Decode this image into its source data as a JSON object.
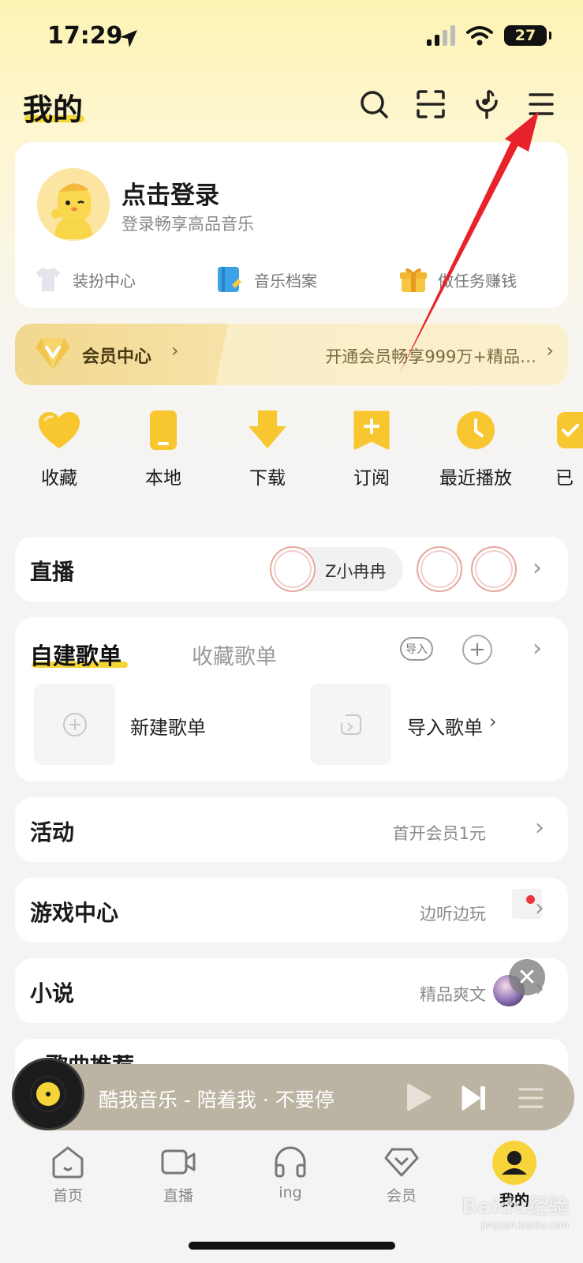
{
  "status": {
    "time": "17:29",
    "battery": "27"
  },
  "header": {
    "title": "我的"
  },
  "profile": {
    "login_title": "点击登录",
    "login_subtitle": "登录畅享高品音乐"
  },
  "quick_links": [
    {
      "label": "装扮中心",
      "icon": "shirt-icon"
    },
    {
      "label": "音乐档案",
      "icon": "notebook-icon"
    },
    {
      "label": "做任务赚钱",
      "icon": "gift-icon"
    }
  ],
  "vip": {
    "title": "会员中心",
    "promo": "开通会员畅享999万+精品…"
  },
  "shortcuts": [
    {
      "label": "收藏",
      "icon": "heart-icon"
    },
    {
      "label": "本地",
      "icon": "phone-icon"
    },
    {
      "label": "下载",
      "icon": "download-icon"
    },
    {
      "label": "订阅",
      "icon": "subscribe-icon"
    },
    {
      "label": "最近播放",
      "icon": "clock-icon"
    },
    {
      "label": "已",
      "icon": "purchased-icon"
    }
  ],
  "live": {
    "label": "直播",
    "streamer": "Z小冉冉"
  },
  "playlists": {
    "tab_created": "自建歌单",
    "tab_collected": "收藏歌单",
    "import_badge": "导入",
    "new_label": "新建歌单",
    "import_label": "导入歌单"
  },
  "rows": {
    "activity": {
      "label": "活动",
      "hint": "首开会员1元"
    },
    "games": {
      "label": "游戏中心",
      "hint": "边听边玩"
    },
    "novel": {
      "label": "小说",
      "hint": "精品爽文"
    },
    "partial": {
      "label": "歌曲推荐"
    }
  },
  "player": {
    "now_playing": "酷我音乐 - 陪着我 · 不要停"
  },
  "tabbar": [
    {
      "label": "首页",
      "icon": "home-icon"
    },
    {
      "label": "直播",
      "icon": "video-icon"
    },
    {
      "label": "ing",
      "icon": "headphones-icon"
    },
    {
      "label": "会员",
      "icon": "diamond-icon"
    },
    {
      "label": "我的",
      "icon": "user-icon"
    }
  ],
  "watermark": {
    "brand": "Baidu经验",
    "url": "jingyan.baidu.com"
  },
  "colors": {
    "accent": "#f5d637",
    "annotation_arrow": "#e8222a"
  }
}
